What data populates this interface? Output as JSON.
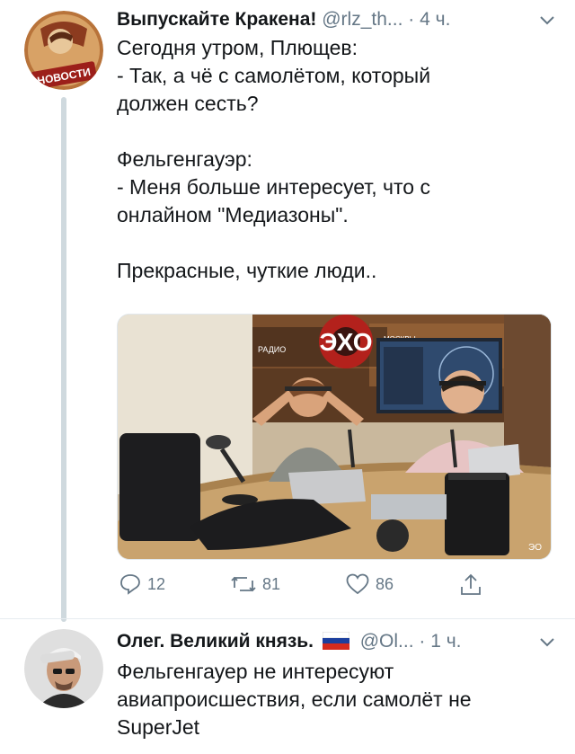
{
  "tweet1": {
    "name": "Выпускайте Кракена!",
    "handle": "@rlz_th...",
    "time": "4 ч.",
    "separator": "·",
    "avatar_label": "НОВОСТИ",
    "lines": [
      "Сегодня утром, Плющев:",
      "- Так, а чё с самолётом, который",
      "должен сесть?",
      "",
      "Фельгенгауэр:",
      "- Меня больше интересует, что с",
      "онлайном \"Медиазоны\".",
      "",
      "Прекрасные, чуткие люди.."
    ],
    "media": {
      "logo_left": "РАДИО",
      "logo_main": "ЭХО",
      "logo_right": "МОСКВЫ",
      "corner_mark": "ЭО"
    },
    "actions": {
      "replies": "12",
      "retweets": "81",
      "likes": "86"
    }
  },
  "tweet2": {
    "name": "Олег. Великий князь.",
    "handle": "@Ol...",
    "time": "1 ч.",
    "separator": "·",
    "lines": [
      "Фельгенгауер не интересуют",
      "авиапроисшествия, если самолёт не",
      "SuperJet"
    ]
  },
  "icons": {
    "reply": "reply-icon",
    "retweet": "retweet-icon",
    "like": "heart-icon",
    "share": "share-icon",
    "chevron": "chevron-down-icon"
  },
  "colors": {
    "text": "#14171a",
    "muted": "#657786",
    "thread_line": "#cfd9de",
    "media_border": "#e1e8ed"
  }
}
